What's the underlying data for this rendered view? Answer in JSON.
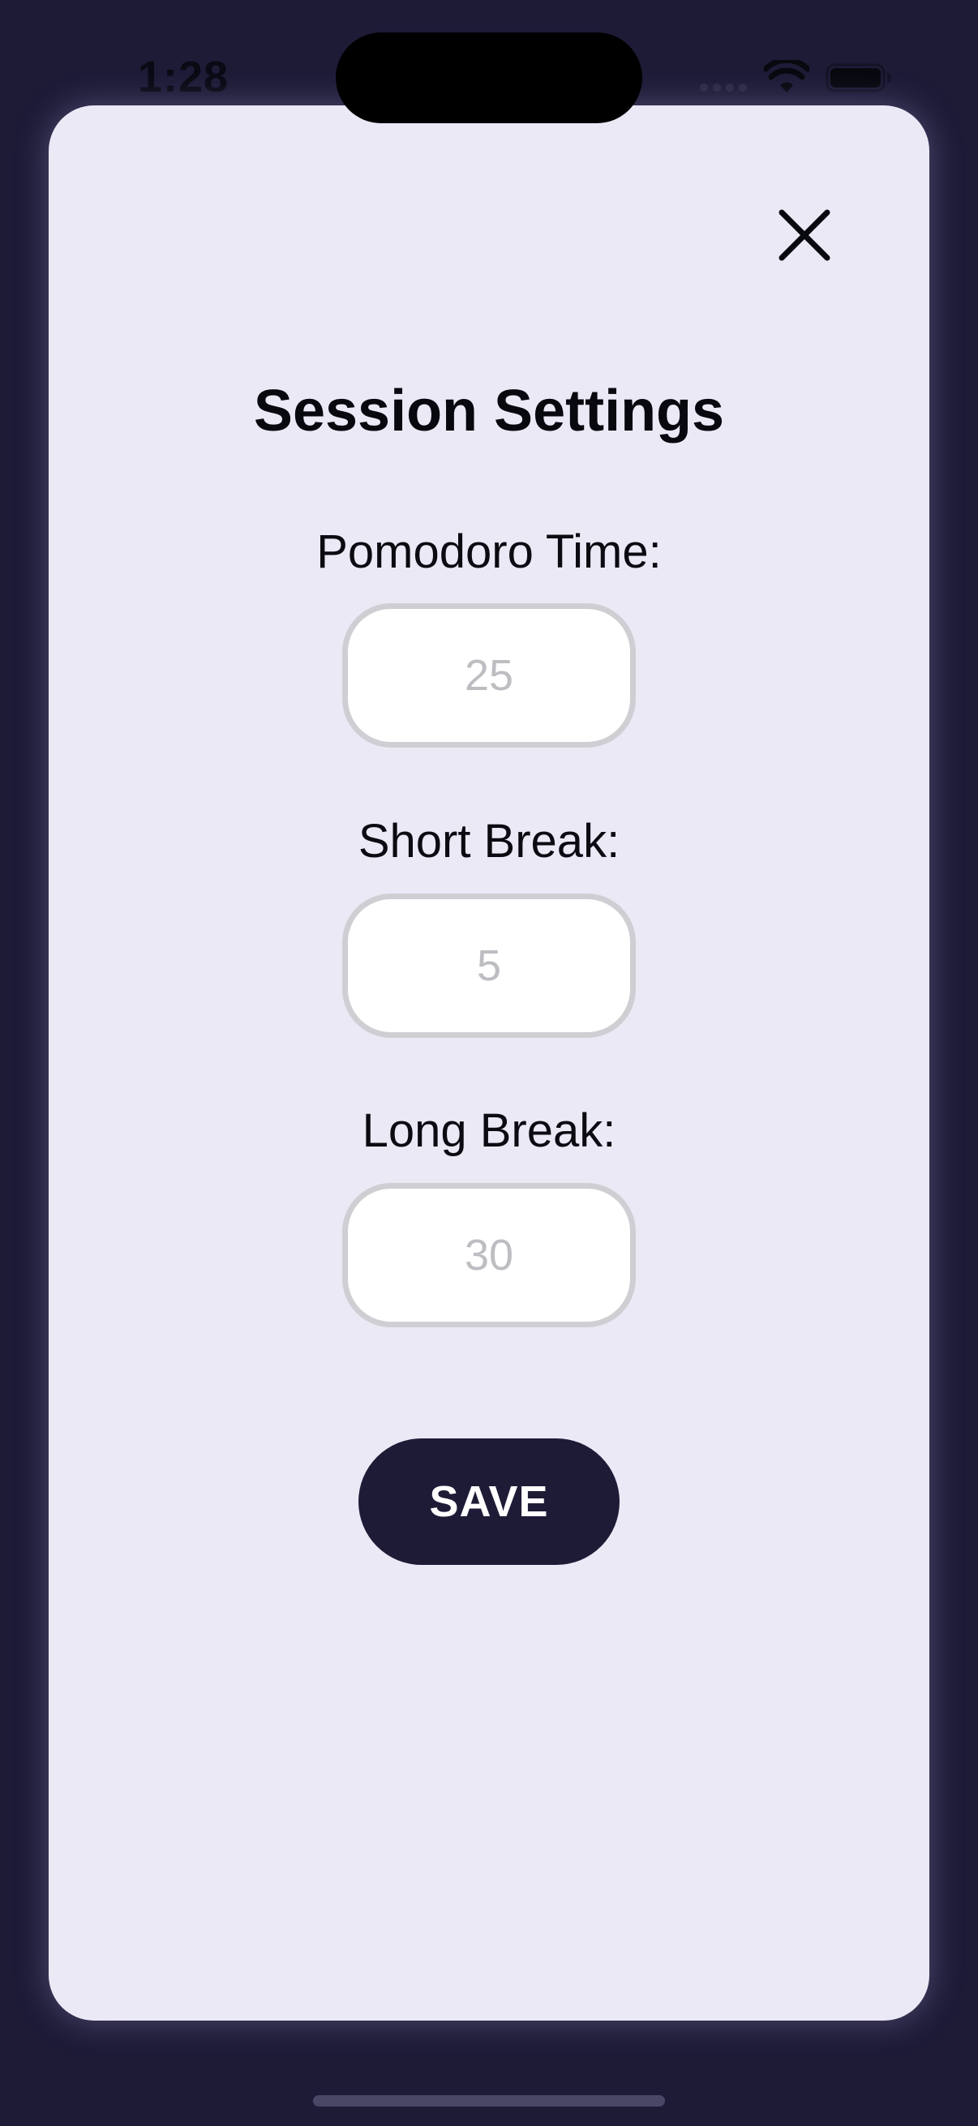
{
  "status_bar": {
    "time": "1:28"
  },
  "modal": {
    "title": "Session Settings",
    "fields": [
      {
        "label": "Pomodoro Time:",
        "value": "",
        "placeholder": "25"
      },
      {
        "label": "Short Break:",
        "value": "",
        "placeholder": "5"
      },
      {
        "label": "Long Break:",
        "value": "",
        "placeholder": "30"
      }
    ],
    "save_label": "SAVE"
  },
  "colors": {
    "background": "#1e1b37",
    "modal_background": "#ece9f7",
    "button_background": "#1e1b37",
    "input_border": "#cfcfd3",
    "placeholder": "#bdbdc2"
  },
  "icons": {
    "close": "close-icon",
    "wifi": "wifi-icon",
    "battery": "battery-icon",
    "signal": "cellular-signal-icon"
  }
}
